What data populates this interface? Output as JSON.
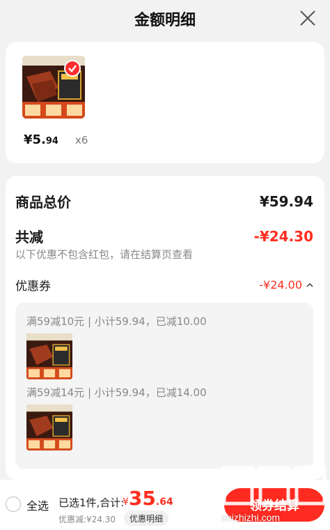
{
  "header": {
    "title": "金额明细"
  },
  "product": {
    "price_int": "¥5.",
    "price_dec": "94",
    "qty": "x6"
  },
  "summary": {
    "total_label": "商品总价",
    "total_value": "¥59.94",
    "cut_label": "共减",
    "cut_value": "-¥24.30",
    "note": "以下优惠不包含红包，请在结算页查看",
    "coupon_label": "优惠券",
    "coupon_value": "-¥24.00"
  },
  "coupons": [
    {
      "line": "满59减10元 | 小计59.94，已减10.00"
    },
    {
      "line": "满59减14元 | 小计59.94，已减14.00"
    }
  ],
  "bottom": {
    "select_all": "全选",
    "selected": "已选1件,合计:",
    "sum_currency": "¥",
    "sum_int": "35",
    "sum_dec": ".64",
    "discount": "优惠减:¥24.30",
    "detail_button": "优惠明细",
    "checkout_button": "领券结算"
  },
  "watermark": {
    "text": "值值值",
    "url": "zhizhizhi.com"
  },
  "colors": {
    "accent": "#ff2e1f",
    "background": "#f2f2f2"
  }
}
